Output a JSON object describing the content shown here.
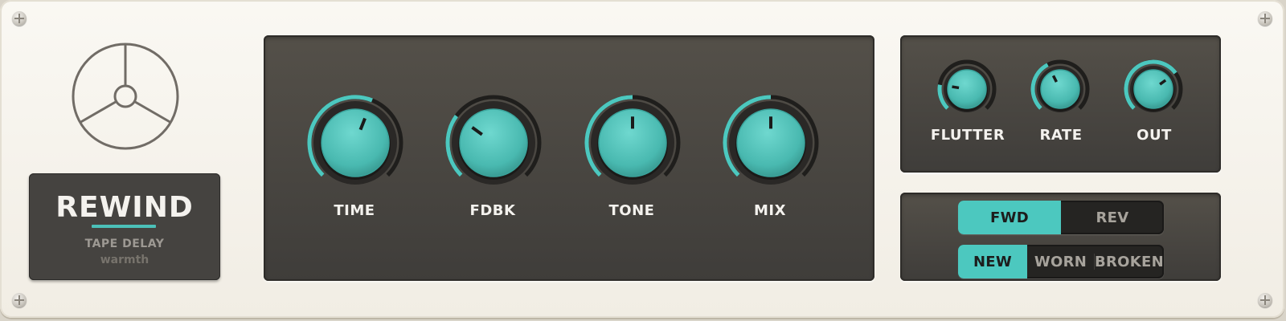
{
  "plugin": {
    "name": "REWIND",
    "subtitle": "TAPE DELAY",
    "preset_tag": "warmth",
    "accent_color": "#4cc8bf"
  },
  "main_knobs": [
    {
      "label": "TIME",
      "value": 0.58
    },
    {
      "label": "FDBK",
      "value": 0.3
    },
    {
      "label": "TONE",
      "value": 0.5
    },
    {
      "label": "MIX",
      "value": 0.5
    }
  ],
  "mod_knobs": [
    {
      "label": "FLUTTER",
      "value": 0.2
    },
    {
      "label": "RATE",
      "value": 0.4
    },
    {
      "label": "OUT",
      "value": 0.7
    }
  ],
  "direction": {
    "options": [
      "FWD",
      "REV"
    ],
    "selected": "FWD"
  },
  "tape_condition": {
    "options": [
      "NEW",
      "WORN",
      "BROKEN"
    ],
    "selected": "NEW"
  }
}
